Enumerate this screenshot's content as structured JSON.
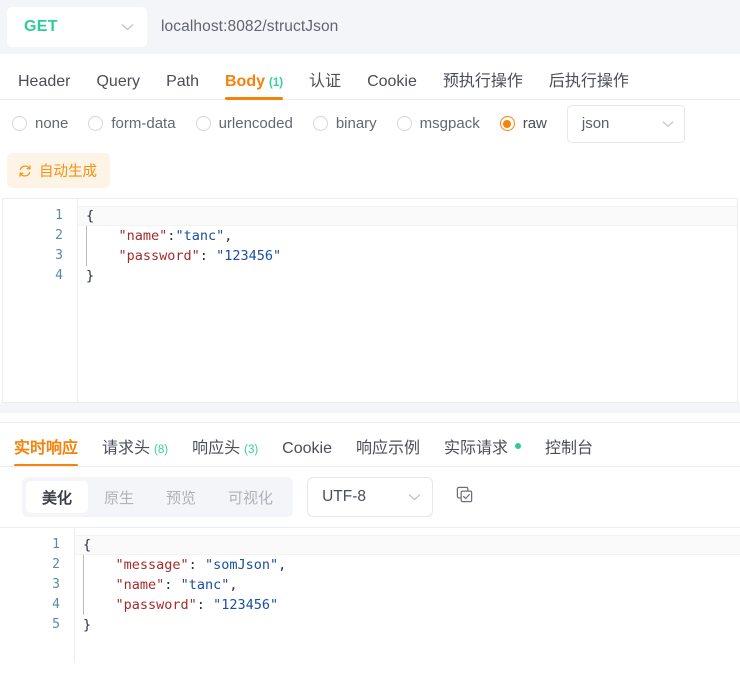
{
  "urlbar": {
    "method": "GET",
    "method_color": "#2ecc9a",
    "url": "localhost:8082/structJson",
    "caret_icon": "chevron-down-icon"
  },
  "request_tabs": [
    {
      "label": "Header",
      "badge": "",
      "active": false
    },
    {
      "label": "Query",
      "badge": "",
      "active": false
    },
    {
      "label": "Path",
      "badge": "",
      "active": false
    },
    {
      "label": "Body",
      "badge": "(1)",
      "active": true
    },
    {
      "label": "认证",
      "badge": "",
      "active": false
    },
    {
      "label": "Cookie",
      "badge": "",
      "active": false
    },
    {
      "label": "预执行操作",
      "badge": "",
      "active": false
    },
    {
      "label": "后执行操作",
      "badge": "",
      "active": false
    }
  ],
  "body_types": [
    {
      "label": "none",
      "checked": false
    },
    {
      "label": "form-data",
      "checked": false
    },
    {
      "label": "urlencoded",
      "checked": false
    },
    {
      "label": "binary",
      "checked": false
    },
    {
      "label": "msgpack",
      "checked": false
    },
    {
      "label": "raw",
      "checked": true
    }
  ],
  "raw_format": {
    "value": "json",
    "caret_icon": "chevron-down-icon"
  },
  "autogen": {
    "label": "自动生成",
    "icon": "refresh-icon",
    "color": "#f5920b"
  },
  "request_body": {
    "line_numbers": [
      "1",
      "2",
      "3",
      "4"
    ],
    "lines": [
      [
        {
          "t": "brace",
          "v": "{"
        }
      ],
      [
        {
          "t": "pad",
          "v": "    "
        },
        {
          "t": "key",
          "v": "\"name\""
        },
        {
          "t": "punc",
          "v": ":"
        },
        {
          "t": "str",
          "v": "\"tanc\""
        },
        {
          "t": "punc",
          "v": ","
        }
      ],
      [
        {
          "t": "pad",
          "v": "    "
        },
        {
          "t": "key",
          "v": "\"password\""
        },
        {
          "t": "punc",
          "v": ": "
        },
        {
          "t": "str",
          "v": "\"123456\""
        }
      ],
      [
        {
          "t": "brace",
          "v": "}"
        }
      ]
    ]
  },
  "response_tabs": [
    {
      "label": "实时响应",
      "badge": "",
      "dot": false,
      "active": true
    },
    {
      "label": "请求头",
      "badge": "(8)",
      "dot": false,
      "active": false
    },
    {
      "label": "响应头",
      "badge": "(3)",
      "dot": false,
      "active": false
    },
    {
      "label": "Cookie",
      "badge": "",
      "dot": false,
      "active": false
    },
    {
      "label": "响应示例",
      "badge": "",
      "dot": false,
      "active": false
    },
    {
      "label": "实际请求",
      "badge": "",
      "dot": true,
      "active": false
    },
    {
      "label": "控制台",
      "badge": "",
      "dot": false,
      "active": false
    }
  ],
  "response_view_modes": [
    {
      "label": "美化",
      "active": true
    },
    {
      "label": "原生",
      "active": false
    },
    {
      "label": "预览",
      "active": false
    },
    {
      "label": "可视化",
      "active": false
    }
  ],
  "encoding": {
    "value": "UTF-8",
    "caret_icon": "chevron-down-icon"
  },
  "copy_button": {
    "icon": "copy-icon"
  },
  "response_body": {
    "line_numbers": [
      "1",
      "2",
      "3",
      "4",
      "5"
    ],
    "lines": [
      [
        {
          "t": "brace",
          "v": "{"
        }
      ],
      [
        {
          "t": "pad",
          "v": "    "
        },
        {
          "t": "key",
          "v": "\"message\""
        },
        {
          "t": "punc",
          "v": ": "
        },
        {
          "t": "str",
          "v": "\"somJson\""
        },
        {
          "t": "punc",
          "v": ","
        }
      ],
      [
        {
          "t": "pad",
          "v": "    "
        },
        {
          "t": "key",
          "v": "\"name\""
        },
        {
          "t": "punc",
          "v": ": "
        },
        {
          "t": "str",
          "v": "\"tanc\""
        },
        {
          "t": "punc",
          "v": ","
        }
      ],
      [
        {
          "t": "pad",
          "v": "    "
        },
        {
          "t": "key",
          "v": "\"password\""
        },
        {
          "t": "punc",
          "v": ": "
        },
        {
          "t": "str",
          "v": "\"123456\""
        }
      ],
      [
        {
          "t": "brace",
          "v": "}"
        }
      ]
    ]
  },
  "theme": {
    "accent": "#f5820b",
    "green": "#2ecc9a",
    "key_color": "#a52a2a",
    "string_color": "#1a4fa0",
    "linenum_color": "#5b88ad"
  }
}
